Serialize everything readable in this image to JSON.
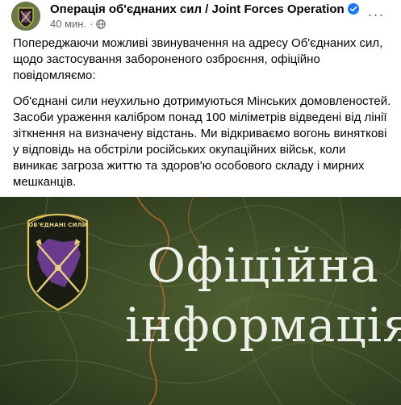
{
  "post": {
    "author": "Операція об'єднаних сил / Joint Forces Operation",
    "time": "40 мин.",
    "time_separator": "·",
    "more_label": "···",
    "paragraphs": [
      "Попереджаючи можливі звинувачення на адресу Об'єднаних сил, щодо застосування забороненого озброєння, офіційно повідомляємо:",
      "Об'єднані сили неухильно дотримуються Мінських домовленостей. Засоби ураження калібром понад 100 міліметрів відведені від лінії зіткнення на визначену відстань. Ми відкриваємо вогонь виняткові у відповідь на обстріли російських окупаційних військ, коли виникає загроза життю та здоров'ю особового складу і мирних мешканців."
    ]
  },
  "image": {
    "emblem_text": "ОБ'ЄДНАНІ СИЛИ",
    "headline_line1": "Офіційна",
    "headline_line2": "інформація"
  },
  "icons": {
    "verified": "verified-badge-icon",
    "globe": "globe-icon",
    "more": "more-options-icon"
  },
  "colors": {
    "author": "#050505",
    "meta": "#65676b",
    "verified": "#1877f2",
    "image_bg": "#3b4a26",
    "headline": "#eef1e9",
    "emblem_shield": "#1b1d14",
    "emblem_border": "#d8c25a",
    "map_purple": "#6a3a8c"
  }
}
